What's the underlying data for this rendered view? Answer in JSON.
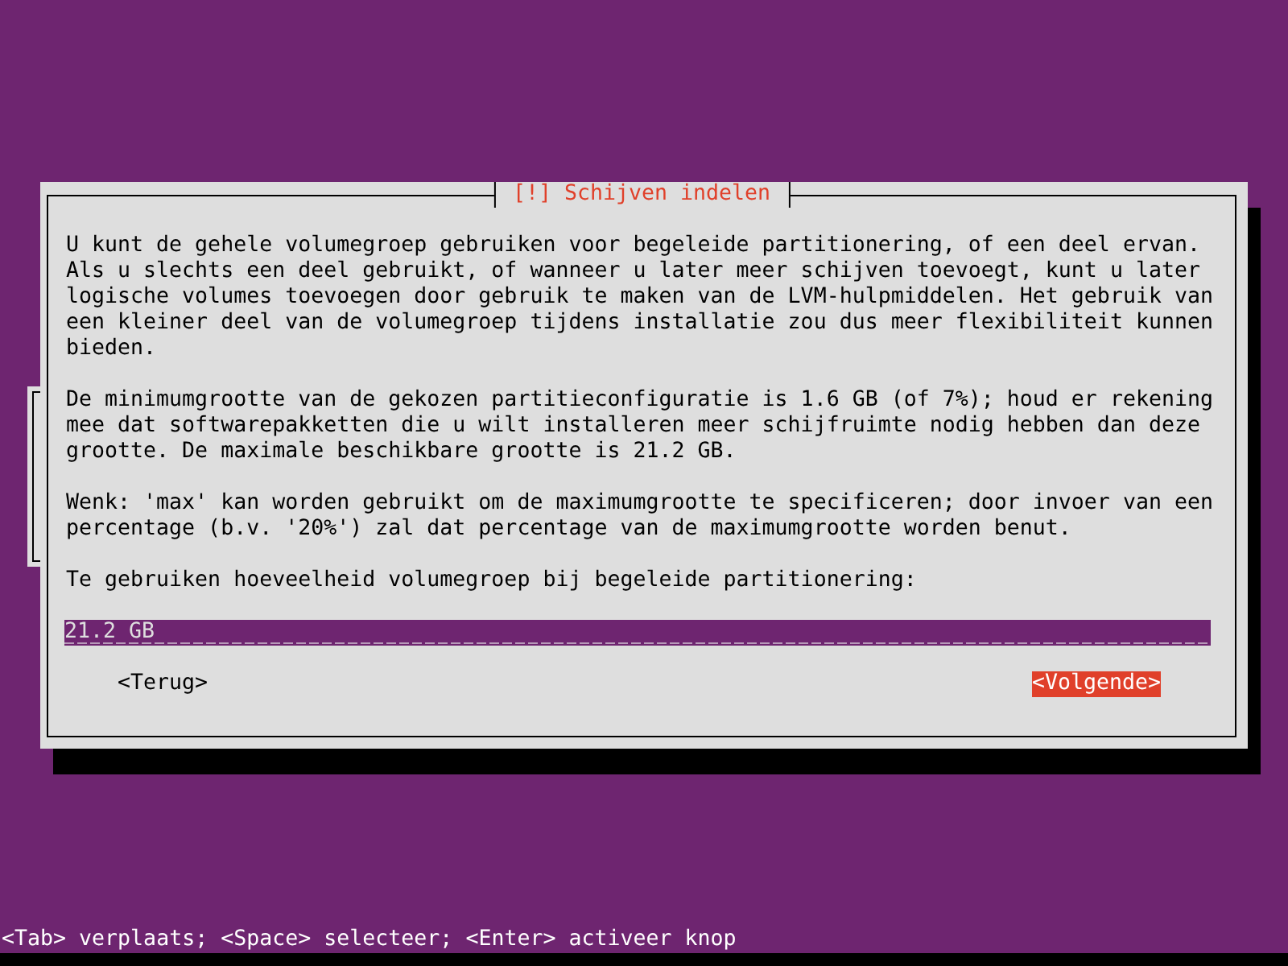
{
  "dialog": {
    "title": "[!] Schijven indelen",
    "paragraphs": [
      "U kunt de gehele volumegroep gebruiken voor begeleide partitionering, of een deel ervan.\nAls u slechts een deel gebruikt, of wanneer u later meer schijven toevoegt, kunt u later\nlogische volumes toevoegen door gebruik te maken van de LVM-hulpmiddelen. Het gebruik van\neen kleiner deel van de volumegroep tijdens installatie zou dus meer flexibiliteit kunnen\nbieden.",
      "De minimumgrootte van de gekozen partitieconfiguratie is 1.6 GB (of 7%); houd er rekening\nmee dat softwarepakketten die u wilt installeren meer schijfruimte nodig hebben dan deze\ngrootte. De maximale beschikbare grootte is 21.2 GB.",
      "Wenk: 'max' kan worden gebruikt om de maximumgrootte te specificeren; door invoer van een\npercentage (b.v. '20%') zal dat percentage van de maximumgrootte worden benut."
    ],
    "prompt": "Te gebruiken hoeveelheid volumegroep bij begeleide partitionering:",
    "field": {
      "value": "21.2 GB"
    },
    "buttons": [
      {
        "label": "<Terug>",
        "selected": false
      },
      {
        "label": "<Volgende>",
        "selected": true
      }
    ]
  },
  "status_bar": "<Tab> verplaats; <Space> selecteer; <Enter> activeer knop"
}
